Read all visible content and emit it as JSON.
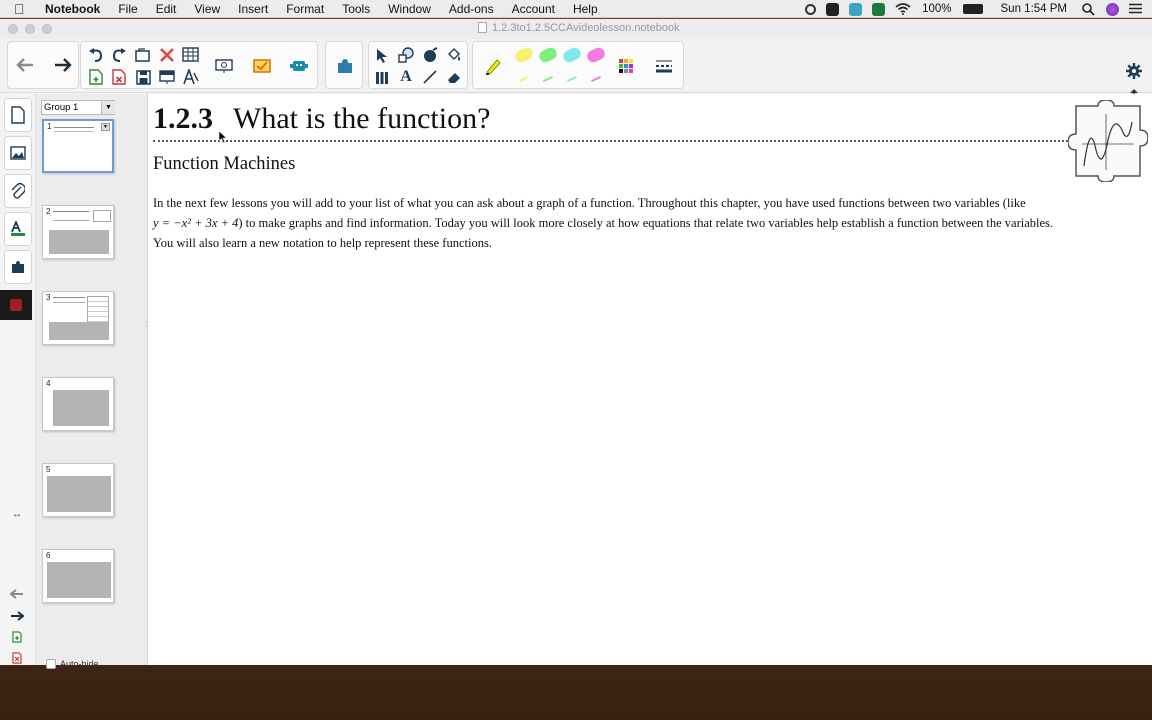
{
  "menubar": {
    "app": "Notebook",
    "items": [
      "File",
      "Edit",
      "View",
      "Insert",
      "Format",
      "Tools",
      "Window",
      "Add-ons",
      "Account",
      "Help"
    ],
    "battery": "100%",
    "clock": "Sun 1:54 PM"
  },
  "window": {
    "title": "1.2.3to1.2.5CCAvideolesson.notebook"
  },
  "sorter": {
    "group_label": "Group 1",
    "pages": [
      "1",
      "2",
      "3",
      "4",
      "5",
      "6"
    ],
    "autohide_label": "Auto-hide"
  },
  "page": {
    "section_number": "1.2.3",
    "title": "What is the function?",
    "subtitle": "Function Machines",
    "para_1": "In the next few lessons you will add to your list of what you can ask about a graph of a function.  Throughout this chapter, you have used functions between two variables (like",
    "para_math": "y = −x² + 3x + 4",
    "para_2": ") to make graphs and find information.  Today you will look more closely at how equations that relate two variables help establish a function between the variables.",
    "para_3": "You will also learn a new notation to help represent these functions."
  },
  "colors": {
    "highlight_yellow": "#f4f26a",
    "highlight_green": "#7ef07e",
    "highlight_cyan": "#7fe9ee",
    "highlight_pink": "#f27be0",
    "selected_page": "#9ec7ef"
  }
}
